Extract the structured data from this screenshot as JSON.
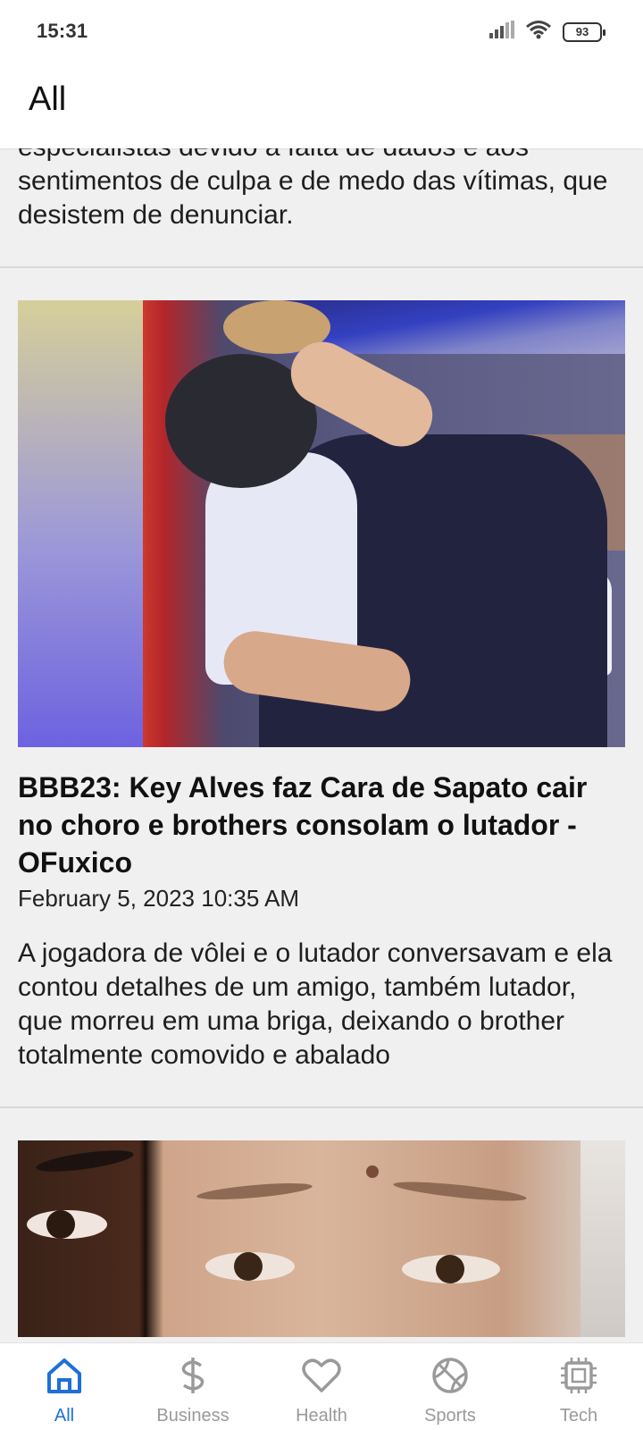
{
  "status_bar": {
    "time": "15:31",
    "battery": "93"
  },
  "app_bar": {
    "title": "All"
  },
  "feed": {
    "previous_article": {
      "description": "especialistas devido à falta de dados e aos sentimentos de culpa e de medo das vítimas, que desistem de denunciar."
    },
    "articles": [
      {
        "headline": "BBB23: Key Alves faz Cara de Sapato cair no choro e brothers consolam o lutador - OFuxico",
        "date": "February 5, 2023 10:35 AM",
        "description": "A jogadora de vôlei e o lutador conversavam e ela contou detalhes de um amigo, também lutador, que morreu em uma briga, deixando o brother totalmente comovido e abalado"
      }
    ]
  },
  "bottom_nav": {
    "items": [
      {
        "label": "All",
        "icon": "home-icon",
        "active": true
      },
      {
        "label": "Business",
        "icon": "dollar-icon",
        "active": false
      },
      {
        "label": "Health",
        "icon": "heart-icon",
        "active": false
      },
      {
        "label": "Sports",
        "icon": "ball-icon",
        "active": false
      },
      {
        "label": "Tech",
        "icon": "chip-icon",
        "active": false
      }
    ]
  },
  "colors": {
    "accent": "#1e6fd9",
    "inactive": "#9a9a9a",
    "background": "#f0f0f0"
  }
}
